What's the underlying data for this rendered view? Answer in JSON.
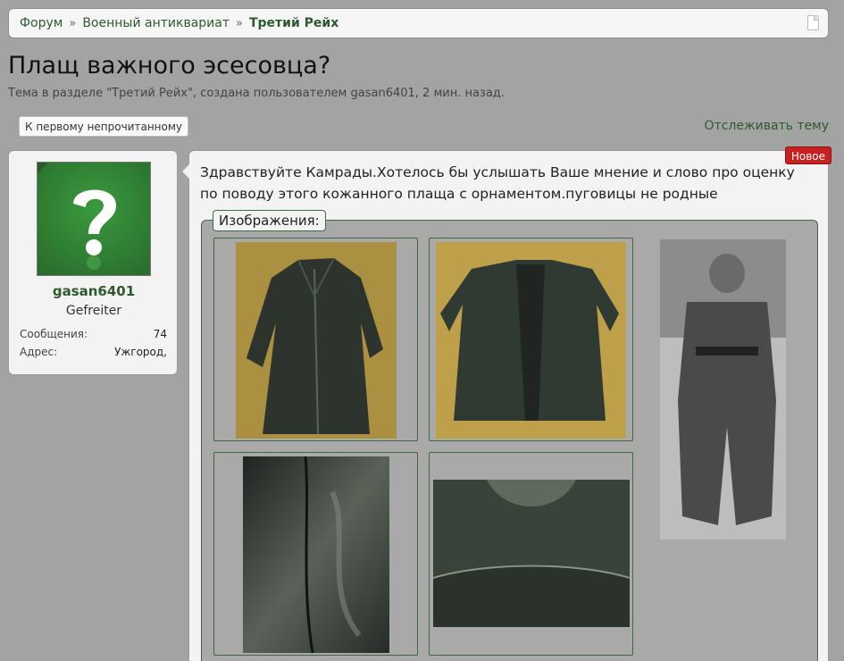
{
  "breadcrumb": {
    "items": [
      "Форум",
      "Военный антиквариат",
      "Третий Рейх"
    ],
    "separator": "»",
    "icon": "page-icon"
  },
  "thread": {
    "title": "Плащ важного эсесовца?",
    "meta": "Тема в разделе \"Третий Рейх\", создана пользователем gasan6401, 2 мин. назад."
  },
  "actions": {
    "first_unread": "К первому непрочитанному",
    "watch": "Отслеживать тему"
  },
  "user": {
    "name": "gasan6401",
    "title": "Gefreiter",
    "messages_label": "Сообщения:",
    "messages_value": "74",
    "address_label": "Адрес:",
    "address_value": "Ужгород,",
    "avatar_icon": "question-mark-icon"
  },
  "post": {
    "badge": "Новое",
    "text": "Здравствуйте Камрады.Хотелось бы услышать Ваше мнение и слово про оценку по поводу этого кожанного плаща с орнаментом.пуговицы не родные",
    "attachments_label": "Изображения:"
  },
  "colors": {
    "background": "#a3a3a3",
    "link": "#2e5a2e",
    "badge": "#c82020",
    "avatar": "#2f7a32"
  }
}
